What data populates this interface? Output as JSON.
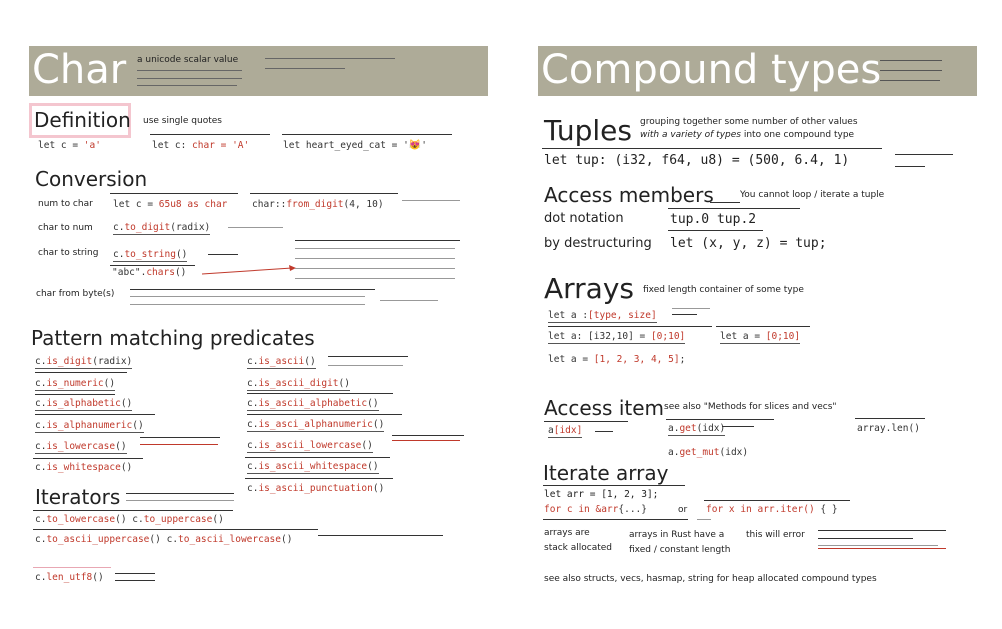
{
  "char": {
    "title": "Char",
    "subtitle": "a unicode scalar value",
    "definition": {
      "heading": "Definition",
      "note": "use single quotes",
      "ex1_a": "let c = ",
      "ex1_b": "'a'",
      "ex2_a": "let c: ",
      "ex2_b": "char = 'A'",
      "ex3_a": "let heart_eyed_cat = '",
      "ex3_emoji": "😻",
      "ex3_b": "'"
    },
    "conversion": {
      "heading": "Conversion",
      "num_to_char": "num to char",
      "ntc_code_a": "let c = ",
      "ntc_code_b": "65u8 as char",
      "ntc_code2_a": "char::",
      "ntc_code2_b": "from_digit",
      "ntc_code2_c": "(4, 10)",
      "char_to_num": "char to num",
      "ctn_code_a": "c.",
      "ctn_code_b": "to_digit",
      "ctn_code_c": "(radix)",
      "char_to_string": "char to string",
      "cts_code_a": "c.",
      "cts_code_b": "to_string",
      "cts_code_c": "()",
      "chars_code_a": "\"abc\".",
      "chars_code_b": "chars",
      "chars_code_c": "()",
      "char_from_bytes": "char from byte(s)"
    },
    "pattern": {
      "heading": "Pattern matching predicates",
      "left": [
        {
          "prefix": "c.",
          "fn": "is_digit",
          "args": "(radix)"
        },
        {
          "prefix": "c.",
          "fn": "is_numeric",
          "args": "()"
        },
        {
          "prefix": "c.",
          "fn": "is_alphabetic",
          "args": "()"
        },
        {
          "prefix": "c.",
          "fn": "is_alphanumeric",
          "args": "()"
        },
        {
          "prefix": "c.",
          "fn": "is_lowercase",
          "args": "()"
        },
        {
          "prefix": "c.",
          "fn": "is_whitespace",
          "args": "()"
        }
      ],
      "right": [
        {
          "prefix": "c.",
          "fn": "is_ascii",
          "args": "()"
        },
        {
          "prefix": "c.",
          "fn": "is_ascii_digit",
          "args": "()"
        },
        {
          "prefix": "c.",
          "fn": "is_ascii_alphabetic",
          "args": "()"
        },
        {
          "prefix": "c.",
          "fn": "is_asci_alphanumeric",
          "args": "()"
        },
        {
          "prefix": "c.",
          "fn": "is_ascii_lowercase",
          "args": "()"
        },
        {
          "prefix": "c.",
          "fn": "is_ascii_whitespace",
          "args": "()"
        },
        {
          "prefix": "c.",
          "fn": "is_ascii_punctuation",
          "args": "()"
        }
      ]
    },
    "iterators": {
      "heading": "Iterators",
      "row1_a": "c.",
      "row1_b": "to_lowercase",
      "row1_c": "()",
      "row1_d": "c.",
      "row1_e": "to_uppercase",
      "row1_f": "()",
      "row2_a": "c.",
      "row2_b": "to_ascii_uppercase",
      "row2_c": "()",
      "row2_d": "c.",
      "row2_e": "to_ascii_lowercase",
      "row2_f": "()"
    },
    "len_a": "c.",
    "len_b": "len_utf8",
    "len_c": "()"
  },
  "compound": {
    "title": "Compound types",
    "tuples": {
      "heading": "Tuples",
      "note1": "grouping together some number of other values",
      "note2_i": "with a variety of types",
      "note2_b": " into one compound type",
      "code": "let tup: (i32, f64, u8) = (500, 6.4, 1)"
    },
    "access": {
      "heading": "Access members",
      "note": "You cannot loop / iterate a tuple",
      "dot_label": "dot notation",
      "dot_code": "tup.0  tup.2",
      "destr_label": "by destructuring",
      "destr_code": "let (x, y, z) = tup;"
    },
    "arrays": {
      "heading": "Arrays",
      "note": "fixed length container of some type",
      "c1_a": "let a :",
      "c1_b": "[type, size]",
      "c2_a": "let a: [i32,10] = ",
      "c2_b": "[0;10]",
      "c3_a": "let a = ",
      "c3_b": "[0;10]",
      "c4_a": "let a = ",
      "c4_b": "[1, 2, 3, 4, 5]",
      "c4_c": ";"
    },
    "access_item": {
      "heading": "Access item",
      "note": "see also \"Methods for slices and vecs\"",
      "idx_a": "a",
      "idx_b": "[idx]",
      "get_a": "a.",
      "get_b": "get",
      "get_c": "(idx)",
      "len": "array.len()",
      "getmut_a": "a.",
      "getmut_b": "get_mut",
      "getmut_c": "(idx)"
    },
    "iterate": {
      "heading": "Iterate array",
      "code1": "let arr = [1, 2, 3];",
      "code2_a": "for c in ",
      "code2_b": "&arr",
      "code2_c": "{...}",
      "or": "or",
      "code3_a": "for x in ",
      "code3_b": "arr.iter()",
      "code3_c": " { }",
      "stack1": "arrays are",
      "stack2": "stack allocated",
      "fixed1": "arrays in Rust have a",
      "fixed2": "fixed / constant length",
      "error": "this will error"
    },
    "footer": "see also structs, vecs, hasmap, string for heap allocated compound types"
  },
  "colors": {
    "band": "#aeab98",
    "accent": "#c0392b",
    "highlight": "#f4c6cf"
  }
}
